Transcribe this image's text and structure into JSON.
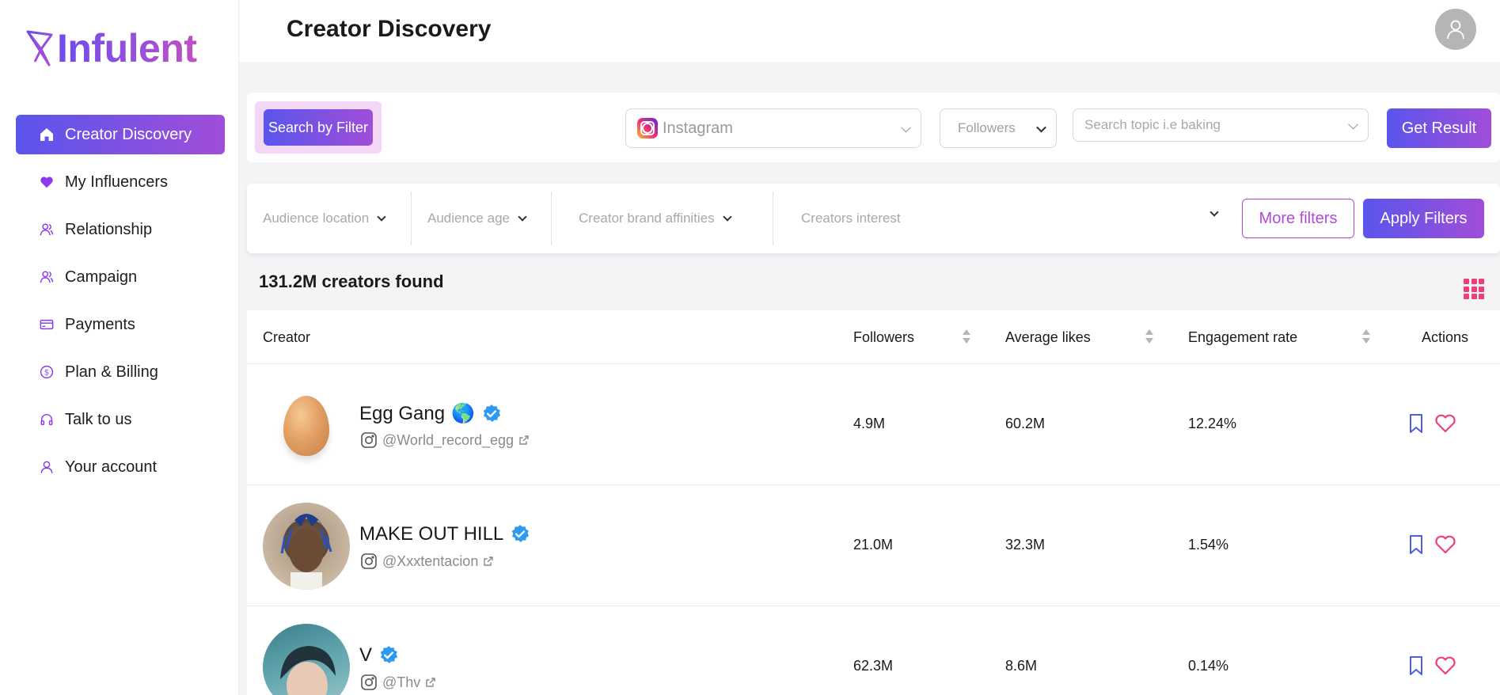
{
  "brand": {
    "name": "Infulent"
  },
  "sidebar": {
    "items": [
      {
        "label": "Creator Discovery",
        "icon": "home-icon",
        "active": true
      },
      {
        "label": "My Influencers",
        "icon": "heart-icon"
      },
      {
        "label": "Relationship",
        "icon": "users-icon"
      },
      {
        "label": "Campaign",
        "icon": "users-icon"
      },
      {
        "label": "Payments",
        "icon": "credit-card-icon"
      },
      {
        "label": "Plan & Billing",
        "icon": "dollar-circle-icon"
      },
      {
        "label": "Talk to us",
        "icon": "headphones-icon"
      },
      {
        "label": "Your account",
        "icon": "user-icon"
      }
    ]
  },
  "header": {
    "title": "Creator Discovery",
    "avatar_icon": "user-avatar-icon"
  },
  "search": {
    "filter_button": "Search by Filter",
    "platform": "Instagram",
    "followers_select": "Followers",
    "topic_placeholder": "Search topic i.e baking",
    "get_result": "Get Result"
  },
  "filters": {
    "audience_location": "Audience location",
    "audience_age": "Audience age",
    "brand_affinities": "Creator brand affinities",
    "creators_interest": "Creators interest",
    "more_filters": "More filters",
    "apply_filters": "Apply Filters"
  },
  "results": {
    "count_text": "131.2M creators found"
  },
  "table": {
    "headers": {
      "creator": "Creator",
      "followers": "Followers",
      "average_likes": "Average likes",
      "engagement_rate": "Engagement rate",
      "actions": "Actions"
    },
    "rows": [
      {
        "name": "Egg Gang",
        "emoji": "🌎",
        "handle": "@World_record_egg",
        "followers": "4.9M",
        "average_likes": "60.2M",
        "engagement_rate": "12.24%"
      },
      {
        "name": "MAKE OUT HILL",
        "handle": "@Xxxtentacion",
        "followers": "21.0M",
        "average_likes": "32.3M",
        "engagement_rate": "1.54%"
      },
      {
        "name": "V",
        "handle": "@Thv",
        "followers": "62.3M",
        "average_likes": "8.6M",
        "engagement_rate": "0.14%"
      }
    ]
  },
  "colors": {
    "accent_start": "#5a55ec",
    "accent_end": "#a04ed8",
    "verified": "#2c9af2",
    "bookmark": "#4c5ee8",
    "heart": "#ee3f7a"
  }
}
